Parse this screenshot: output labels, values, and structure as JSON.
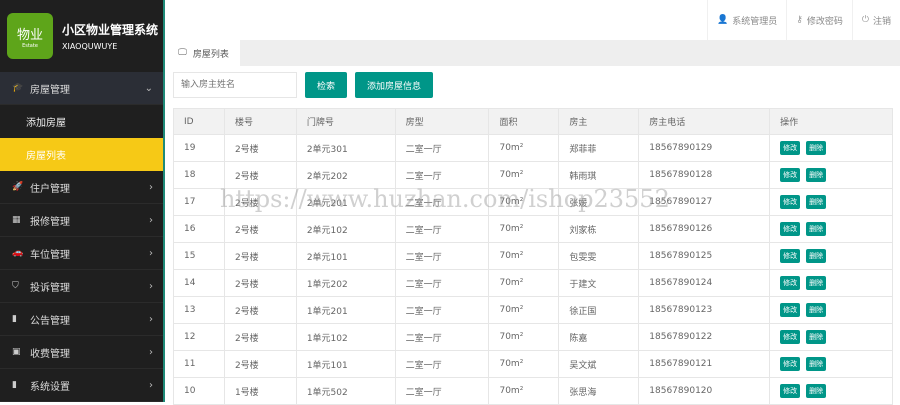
{
  "app": {
    "title": "小区物业管理系统",
    "subtitle": "XIAOQUWUYE",
    "logo_text": "物业",
    "logo_small": "Estate"
  },
  "sidebar": [
    {
      "label": "房屋管理",
      "icon": "graduation-cap-icon",
      "open": true,
      "children": [
        "添加房屋",
        "房屋列表"
      ],
      "active": "房屋列表"
    },
    {
      "label": "住户管理",
      "icon": "rocket-icon"
    },
    {
      "label": "报修管理",
      "icon": "calculator-icon"
    },
    {
      "label": "车位管理",
      "icon": "car-icon"
    },
    {
      "label": "投诉管理",
      "icon": "shield-icon"
    },
    {
      "label": "公告管理",
      "icon": "bar-chart-icon"
    },
    {
      "label": "收费管理",
      "icon": "money-icon"
    },
    {
      "label": "系统设置",
      "icon": "settings-chart-icon"
    }
  ],
  "header": {
    "user": "系统管理员",
    "change_password": "修改密码",
    "logout": "注销"
  },
  "tab": "房屋列表",
  "search": {
    "placeholder": "输入房主姓名",
    "search_btn": "检索",
    "add_btn": "添加房屋信息"
  },
  "table": {
    "columns": [
      "ID",
      "楼号",
      "门牌号",
      "房型",
      "面积",
      "房主",
      "房主电话",
      "操作"
    ],
    "actions": [
      "修改",
      "删除"
    ],
    "rows": [
      [
        "19",
        "2号楼",
        "2单元301",
        "二室一厅",
        "70m²",
        "郑菲菲",
        "18567890129"
      ],
      [
        "18",
        "2号楼",
        "2单元202",
        "二室一厅",
        "70m²",
        "韩雨琪",
        "18567890128"
      ],
      [
        "17",
        "2号楼",
        "2单元201",
        "二室一厅",
        "70m²",
        "张媛",
        "18567890127"
      ],
      [
        "16",
        "2号楼",
        "2单元102",
        "二室一厅",
        "70m²",
        "刘家栋",
        "18567890126"
      ],
      [
        "15",
        "2号楼",
        "2单元101",
        "二室一厅",
        "70m²",
        "包雯雯",
        "18567890125"
      ],
      [
        "14",
        "2号楼",
        "1单元202",
        "二室一厅",
        "70m²",
        "于建文",
        "18567890124"
      ],
      [
        "13",
        "2号楼",
        "1单元201",
        "二室一厅",
        "70m²",
        "徐正国",
        "18567890123"
      ],
      [
        "12",
        "2号楼",
        "1单元102",
        "二室一厅",
        "70m²",
        "陈嘉",
        "18567890122"
      ],
      [
        "11",
        "2号楼",
        "1单元101",
        "二室一厅",
        "70m²",
        "吴文斌",
        "18567890121"
      ],
      [
        "10",
        "1号楼",
        "1单元502",
        "二室一厅",
        "70m²",
        "张思海",
        "18567890120"
      ]
    ]
  },
  "watermark": "https://www.huzhan.com/ishop23552"
}
